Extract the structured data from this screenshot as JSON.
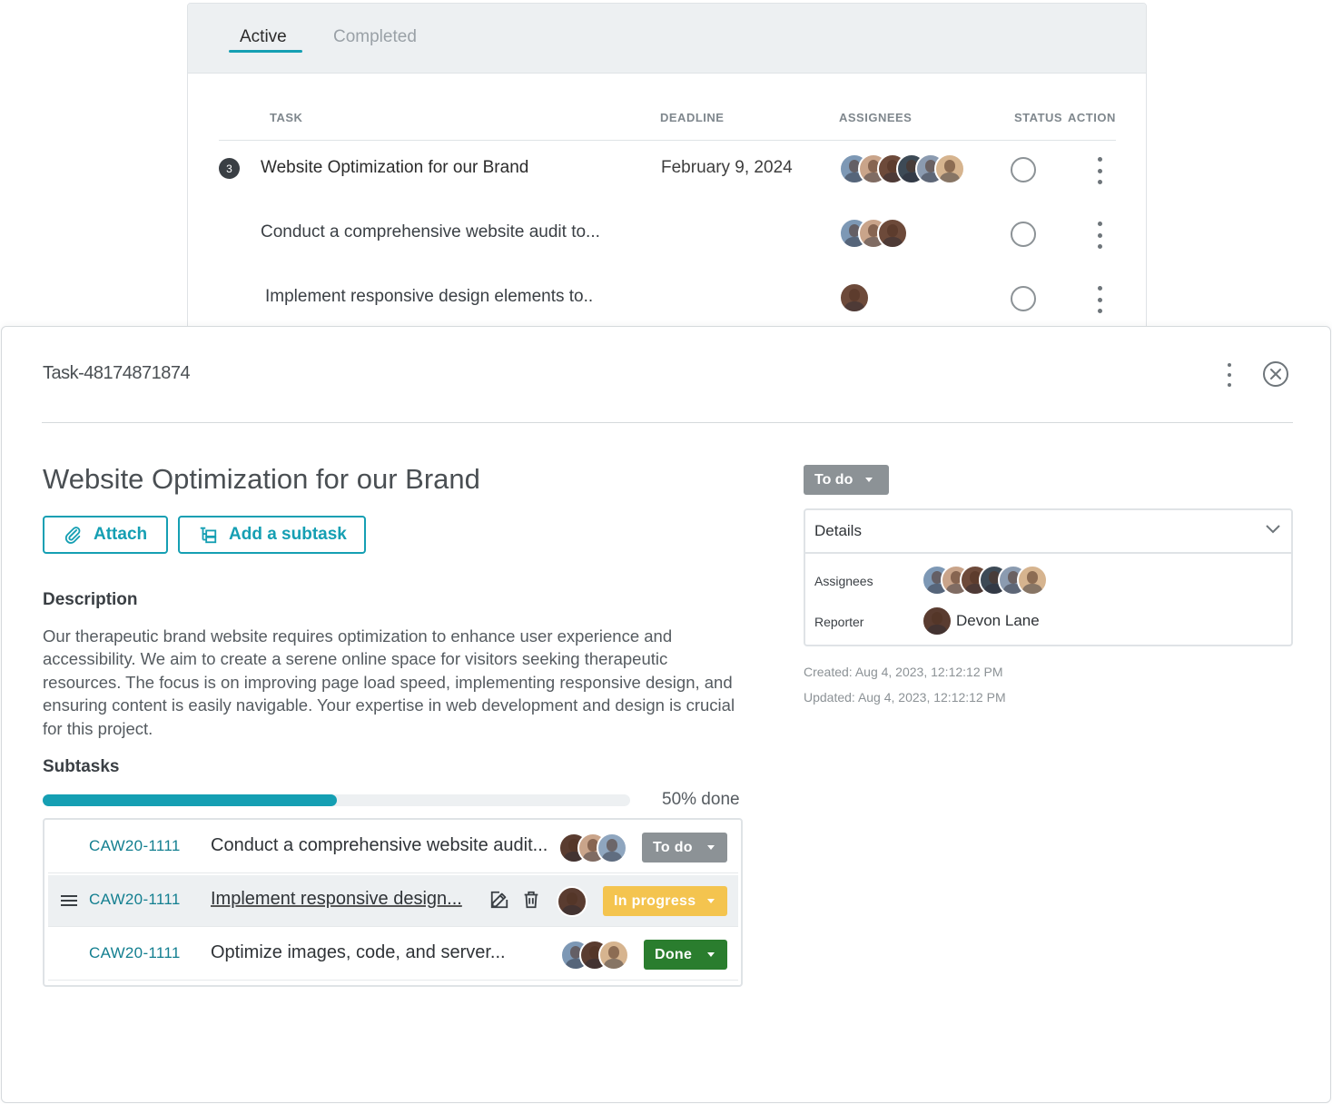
{
  "tabs": [
    {
      "label": "Active",
      "active": true
    },
    {
      "label": "Completed",
      "active": false
    }
  ],
  "table": {
    "headers": [
      "TASK",
      "DEADLINE",
      "ASSIGNEES",
      "STATUS",
      "ACTION"
    ],
    "rows": [
      {
        "badge": "3",
        "task": "Website Optimization for our Brand",
        "deadline": "February 9, 2024",
        "assignee_count": 6
      },
      {
        "badge": "",
        "task": "Conduct a comprehensive website audit to...",
        "deadline": "",
        "assignee_count": 3
      },
      {
        "badge": "",
        "task": "Implement responsive design elements to..",
        "deadline": "",
        "assignee_count": 1
      }
    ]
  },
  "modal": {
    "task_id": "Task-48174871874",
    "title": "Website Optimization for our Brand",
    "attach_label": "Attach",
    "add_subtask_label": "Add a subtask",
    "description_label": "Description",
    "description": "Our therapeutic brand website requires optimization to enhance user experience and accessibility. We aim to create a serene online space for visitors seeking therapeutic resources. The focus is on improving page load speed, implementing responsive design, and ensuring content is easily navigable. Your expertise in web development and design is crucial for this project.",
    "subtasks_label": "Subtasks",
    "progress": 0.5,
    "progress_text": "50% done",
    "subtasks": [
      {
        "code": "CAW20-1111",
        "title": "Conduct a comprehensive website audit...",
        "status": "To do",
        "status_color": "#8c9296",
        "assignee_count": 3
      },
      {
        "code": "CAW20-1111",
        "title": "Implement responsive design...",
        "status": "In progress",
        "status_color": "#f4c44f",
        "assignee_count": 1
      },
      {
        "code": "CAW20-1111",
        "title": "Optimize images, code, and server...",
        "status": "Done",
        "status_color": "#2a7d2e",
        "assignee_count": 3
      }
    ],
    "status_top": "To do",
    "details": {
      "title": "Details",
      "assignees_label": "Assignees",
      "reporter_label": "Reporter",
      "reporter_name": "Devon Lane",
      "assignee_count": 6
    },
    "created": "Created: Aug 4, 2023, 12:12:12 PM",
    "updated": "Updated: Aug 4, 2023, 12:12:12 PM"
  },
  "colors": {
    "accent": "#159fb3",
    "todo": "#8c9296",
    "in_progress": "#f4c44f",
    "done": "#2a7d2e"
  },
  "icons": [
    "kebab-menu-icon",
    "close-icon",
    "paperclip-icon",
    "subtask-icon",
    "chevron-down-icon",
    "drag-handle-icon",
    "edit-icon",
    "trash-icon",
    "status-circle-icon"
  ]
}
